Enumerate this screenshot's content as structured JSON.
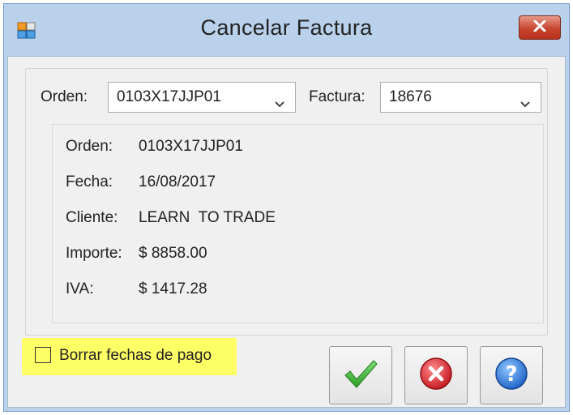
{
  "window": {
    "title": "Cancelar Factura"
  },
  "selectors": {
    "orden_label": "Orden:",
    "orden_value": "0103X17JJP01",
    "factura_label": "Factura:",
    "factura_value": "18676"
  },
  "info": {
    "rows": [
      {
        "label": "Orden:",
        "value": "0103X17JJP01"
      },
      {
        "label": "Fecha:",
        "value": "16/08/2017"
      },
      {
        "label": "Cliente:",
        "value": "LEARN  TO TRADE"
      },
      {
        "label": "Importe:",
        "value": "$ 8858.00"
      },
      {
        "label": "IVA:",
        "value": "$ 1417.28"
      }
    ]
  },
  "options": {
    "borrar_fechas_label": "Borrar fechas de pago",
    "borrar_fechas_checked": false
  },
  "icons": {
    "app": "app-window-icon",
    "close": "close-icon",
    "accept": "checkmark-icon",
    "cancel": "cancel-x-icon",
    "help": "help-question-icon",
    "dropdown": "chevron-down-icon"
  },
  "colors": {
    "highlight": "#ffff66",
    "title_bar": "#b9d1ea",
    "close_red": "#c7452e",
    "check_green": "#3bbd2e",
    "cancel_red": "#d9343a",
    "help_blue": "#2f7fe0"
  }
}
